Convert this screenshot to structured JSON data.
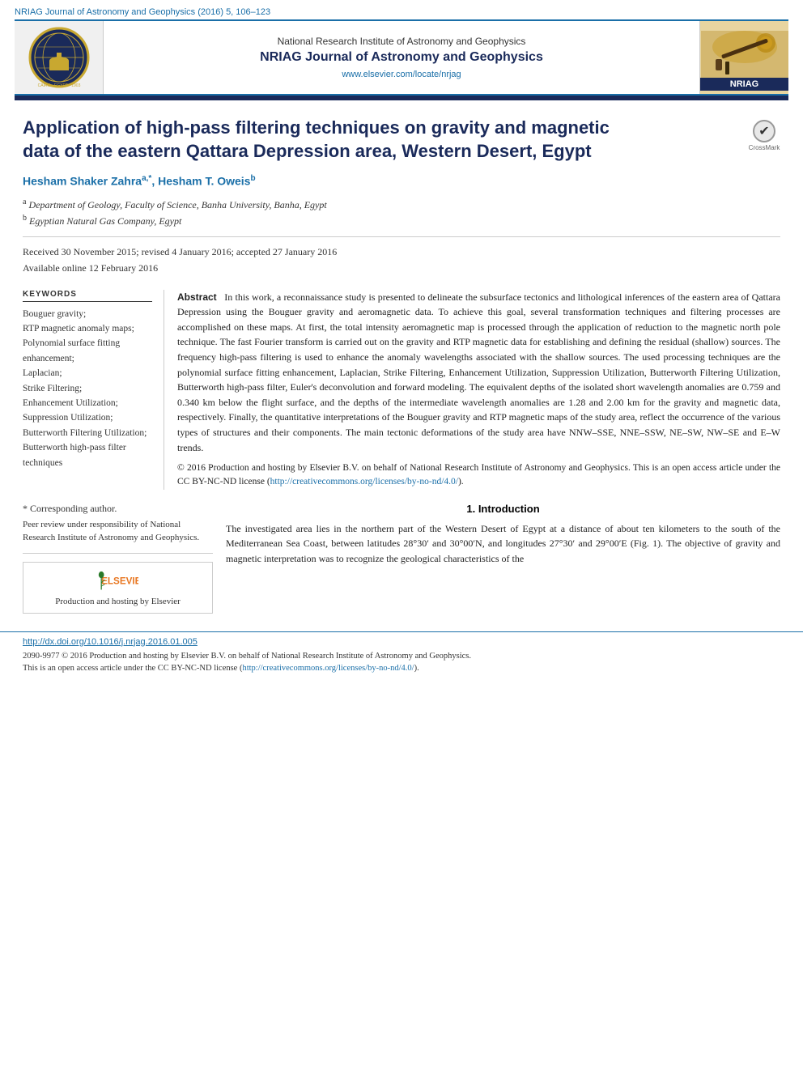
{
  "journal_bar": {
    "text": "NRIAG Journal of Astronomy and Geophysics (2016) 5, 106–123"
  },
  "header": {
    "institute": "National Research Institute of Astronomy and Geophysics",
    "journal_title": "NRIAG Journal of Astronomy and Geophysics",
    "url": "www.elsevier.com/locate/nrjag",
    "badge": "NRIAG"
  },
  "article": {
    "title": "Application of high-pass filtering techniques on gravity and magnetic data of the eastern Qattara Depression area, Western Desert, Egypt",
    "crossmark_label": "CrossMark",
    "authors": "Hesham Shaker Zahra a,*, Hesham T. Oweis b",
    "author_a": "Hesham Shaker Zahra",
    "author_a_sup": "a,*",
    "author_b": "Hesham T. Oweis",
    "author_b_sup": "b",
    "affiliation_a": "a Department of Geology, Faculty of Science, Banha University, Banha, Egypt",
    "affiliation_b": "b Egyptian Natural Gas Company, Egypt",
    "received": "Received 30 November 2015; revised 4 January 2016; accepted 27 January 2016",
    "available": "Available online 12 February 2016"
  },
  "keywords": {
    "header": "KEYWORDS",
    "list": [
      "Bouguer gravity;",
      "RTP magnetic anomaly maps;",
      "Polynomial surface fitting enhancement;",
      "Laplacian;",
      "Strike Filtering;",
      "Enhancement Utilization;",
      "Suppression Utilization;",
      "Butterworth Filtering Utilization;",
      "Butterworth high-pass filter techniques"
    ]
  },
  "abstract": {
    "label": "Abstract",
    "text": "In this work, a reconnaissance study is presented to delineate the subsurface tectonics and lithological inferences of the eastern area of Qattara Depression using the Bouguer gravity and aeromagnetic data. To achieve this goal, several transformation techniques and filtering processes are accomplished on these maps. At first, the total intensity aeromagnetic map is processed through the application of reduction to the magnetic north pole technique. The fast Fourier transform is carried out on the gravity and RTP magnetic data for establishing and defining the residual (shallow) sources. The frequency high-pass filtering is used to enhance the anomaly wavelengths associated with the shallow sources. The used processing techniques are the polynomial surface fitting enhancement, Laplacian, Strike Filtering, Enhancement Utilization, Suppression Utilization, Butterworth Filtering Utilization, Butterworth high-pass filter, Euler's deconvolution and forward modeling. The equivalent depths of the isolated short wavelength anomalies are 0.759 and 0.340 km below the flight surface, and the depths of the intermediate wavelength anomalies are 1.28 and 2.00 km for the gravity and magnetic data, respectively. Finally, the quantitative interpretations of the Bouguer gravity and RTP magnetic maps of the study area, reflect the occurrence of the various types of structures and their components. The main tectonic deformations of the study area have NNW–SSE, NNE–SSW, NE–SW, NW–SE and E–W trends.",
    "copyright_line1": "© 2016 Production and hosting by Elsevier B.V. on behalf of National Research Institute of Astronomy and Geophysics. This is an open access article under the CC BY-NC-ND license (",
    "copyright_link": "http://creativecommons.org/licenses/by-no-nd/4.0/",
    "copyright_line2": ")."
  },
  "footnote": {
    "star": "* Corresponding author.",
    "peer_review": "Peer review under responsibility of National Research Institute of Astronomy and Geophysics.",
    "elsevier_text": "Production and hosting by Elsevier"
  },
  "introduction": {
    "section_number": "1.",
    "section_title": "Introduction",
    "text": "The investigated area lies in the northern part of the Western Desert of Egypt at a distance of about ten kilometers to the south of the Mediterranean Sea Coast, between latitudes 28°30′ and 30°00′N, and longitudes 27°30′ and 29°00′E (Fig. 1). The objective of gravity and magnetic interpretation was to recognize the geological characteristics of the"
  },
  "bottom": {
    "doi": "http://dx.doi.org/10.1016/j.nrjag.2016.01.005",
    "copyright": "2090-9977 © 2016 Production and hosting by Elsevier B.V. on behalf of National Research Institute of Astronomy and Geophysics.",
    "open_access": "This is an open access article under the CC BY-NC-ND license (",
    "license_link": "http://creativecommons.org/licenses/by-no-nd/4.0/",
    "license_end": ")."
  }
}
